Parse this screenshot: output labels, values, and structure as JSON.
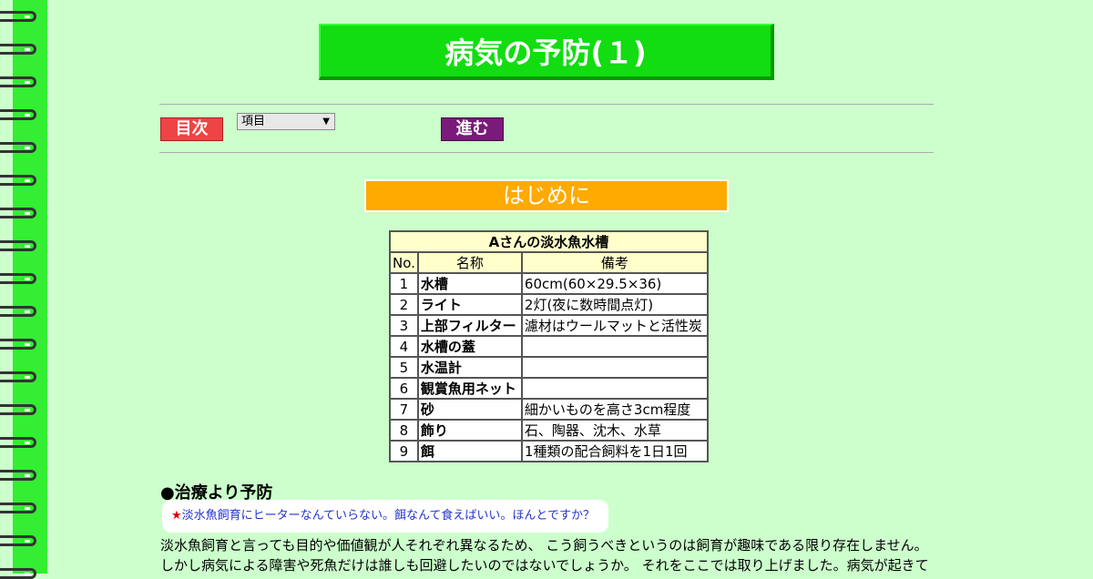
{
  "page_title": "病気の予防(１)",
  "nav": {
    "index_label": "目次",
    "select_value": "項目",
    "next_label": "進む"
  },
  "section_title": "はじめに",
  "table": {
    "caption": "Aさんの淡水魚水槽",
    "headers": [
      "No.",
      "名称",
      "備考"
    ],
    "rows": [
      {
        "no": "1",
        "name": "水槽",
        "note": "60cm(60×29.5×36)"
      },
      {
        "no": "2",
        "name": "ライト",
        "note": "2灯(夜に数時間点灯)"
      },
      {
        "no": "3",
        "name": "上部フィルター",
        "note": "濾材はウールマットと活性炭"
      },
      {
        "no": "4",
        "name": "水槽の蓋",
        "note": ""
      },
      {
        "no": "5",
        "name": "水温計",
        "note": ""
      },
      {
        "no": "6",
        "name": "観賞魚用ネット",
        "note": ""
      },
      {
        "no": "7",
        "name": "砂",
        "note": "細かいものを高さ3cm程度"
      },
      {
        "no": "8",
        "name": "飾り",
        "note": "石、陶器、沈木、水草"
      },
      {
        "no": "9",
        "name": "餌",
        "note": "1種類の配合飼料を1日1回"
      }
    ]
  },
  "heading": "●治療より予防",
  "bubble": {
    "star": "★",
    "text": "淡水魚飼育にヒーターなんていらない。餌なんて食えばいい。ほんとですか？"
  },
  "paragraph": {
    "line1": "淡水魚飼育と言っても目的や価値観が人それぞれ異なるため、 こう飼うべきというのは飼育が趣味である限り存在しません。",
    "line2": "しかし病気による障害や死魚だけは誰しも回避したいのではないでしょうか。 それをここでは取り上げました。病気が起きて"
  },
  "colors": {
    "background": "#ccffcc",
    "binder": "#33ee33",
    "title_bg": "#11dd11",
    "section_bg": "#ffaa00",
    "index_btn": "#ee4444",
    "next_btn": "#7a1a7a"
  }
}
